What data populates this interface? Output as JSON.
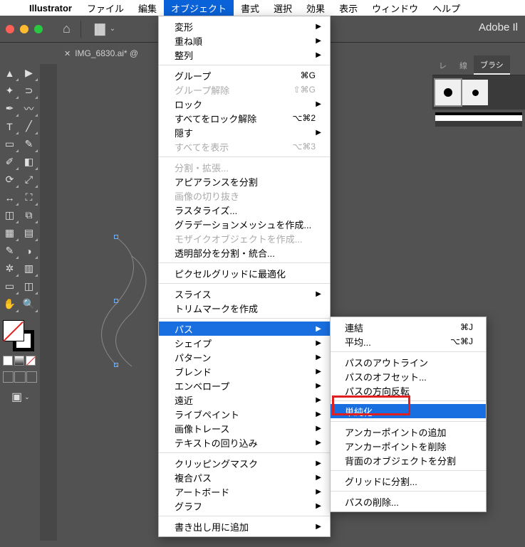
{
  "macmenu": {
    "app": "Illustrator",
    "items": [
      "ファイル",
      "編集",
      "オブジェクト",
      "書式",
      "選択",
      "効果",
      "表示",
      "ウィンドウ",
      "ヘルプ"
    ],
    "active_index": 2
  },
  "brand": "Adobe Il",
  "document_tab": "IMG_6830.ai* @",
  "dropdown": {
    "groups": [
      [
        {
          "label": "変形",
          "arrow": true
        },
        {
          "label": "重ね順",
          "arrow": true
        },
        {
          "label": "整列",
          "arrow": true
        }
      ],
      [
        {
          "label": "グループ",
          "shortcut": "⌘G"
        },
        {
          "label": "グループ解除",
          "shortcut": "⇧⌘G",
          "disabled": true
        },
        {
          "label": "ロック",
          "arrow": true
        },
        {
          "label": "すべてをロック解除",
          "shortcut": "⌥⌘2"
        },
        {
          "label": "隠す",
          "arrow": true
        },
        {
          "label": "すべてを表示",
          "shortcut": "⌥⌘3",
          "disabled": true
        }
      ],
      [
        {
          "label": "分割・拡張...",
          "disabled": true
        },
        {
          "label": "アピアランスを分割"
        },
        {
          "label": "画像の切り抜き",
          "disabled": true
        },
        {
          "label": "ラスタライズ..."
        },
        {
          "label": "グラデーションメッシュを作成..."
        },
        {
          "label": "モザイクオブジェクトを作成...",
          "disabled": true
        },
        {
          "label": "透明部分を分割・統合..."
        }
      ],
      [
        {
          "label": "ピクセルグリッドに最適化"
        }
      ],
      [
        {
          "label": "スライス",
          "arrow": true
        },
        {
          "label": "トリムマークを作成"
        }
      ],
      [
        {
          "label": "パス",
          "arrow": true,
          "selected": true
        },
        {
          "label": "シェイプ",
          "arrow": true
        },
        {
          "label": "パターン",
          "arrow": true
        },
        {
          "label": "ブレンド",
          "arrow": true
        },
        {
          "label": "エンベロープ",
          "arrow": true
        },
        {
          "label": "遠近",
          "arrow": true
        },
        {
          "label": "ライブペイント",
          "arrow": true
        },
        {
          "label": "画像トレース",
          "arrow": true
        },
        {
          "label": "テキストの回り込み",
          "arrow": true
        }
      ],
      [
        {
          "label": "クリッピングマスク",
          "arrow": true
        },
        {
          "label": "複合パス",
          "arrow": true
        },
        {
          "label": "アートボード",
          "arrow": true
        },
        {
          "label": "グラフ",
          "arrow": true
        }
      ],
      [
        {
          "label": "書き出し用に追加",
          "arrow": true
        }
      ]
    ]
  },
  "submenu": {
    "groups": [
      [
        {
          "label": "連結",
          "shortcut": "⌘J"
        },
        {
          "label": "平均...",
          "shortcut": "⌥⌘J"
        }
      ],
      [
        {
          "label": "パスのアウトライン"
        },
        {
          "label": "パスのオフセット..."
        },
        {
          "label": "パスの方向反転"
        }
      ],
      [
        {
          "label": "単純化...",
          "selected": true
        }
      ],
      [
        {
          "label": "アンカーポイントの追加"
        },
        {
          "label": "アンカーポイントを削除"
        },
        {
          "label": "背面のオブジェクトを分割"
        }
      ],
      [
        {
          "label": "グリッドに分割..."
        }
      ],
      [
        {
          "label": "パスの削除..."
        }
      ]
    ]
  },
  "right_panel": {
    "tabs": [
      "レ",
      "線",
      "ブラシ"
    ],
    "active_tab": 2
  },
  "tool_names": [
    [
      "selection",
      "direct-selection"
    ],
    [
      "magic-wand",
      "lasso"
    ],
    [
      "pen",
      "curvature"
    ],
    [
      "type",
      "line-segment"
    ],
    [
      "rectangle",
      "paintbrush"
    ],
    [
      "shaper",
      "eraser"
    ],
    [
      "rotate",
      "scale"
    ],
    [
      "width",
      "free-transform"
    ],
    [
      "shape-builder",
      "perspective"
    ],
    [
      "mesh",
      "gradient"
    ],
    [
      "eyedropper",
      "blend"
    ],
    [
      "symbol-sprayer",
      "column-graph"
    ],
    [
      "artboard",
      "slice"
    ],
    [
      "hand",
      "zoom"
    ]
  ],
  "tool_glyphs": [
    [
      "▲",
      "▶"
    ],
    [
      "✦",
      "⊃"
    ],
    [
      "✒",
      "〰"
    ],
    [
      "T",
      "╱"
    ],
    [
      "▭",
      "✎"
    ],
    [
      "✐",
      "◧"
    ],
    [
      "⟳",
      "⤢"
    ],
    [
      "↔",
      "⛶"
    ],
    [
      "◫",
      "⧉"
    ],
    [
      "▦",
      "▤"
    ],
    [
      "✎",
      "◑"
    ],
    [
      "✲",
      "▥"
    ],
    [
      "▭",
      "◫"
    ],
    [
      "✋",
      "🔍"
    ]
  ]
}
